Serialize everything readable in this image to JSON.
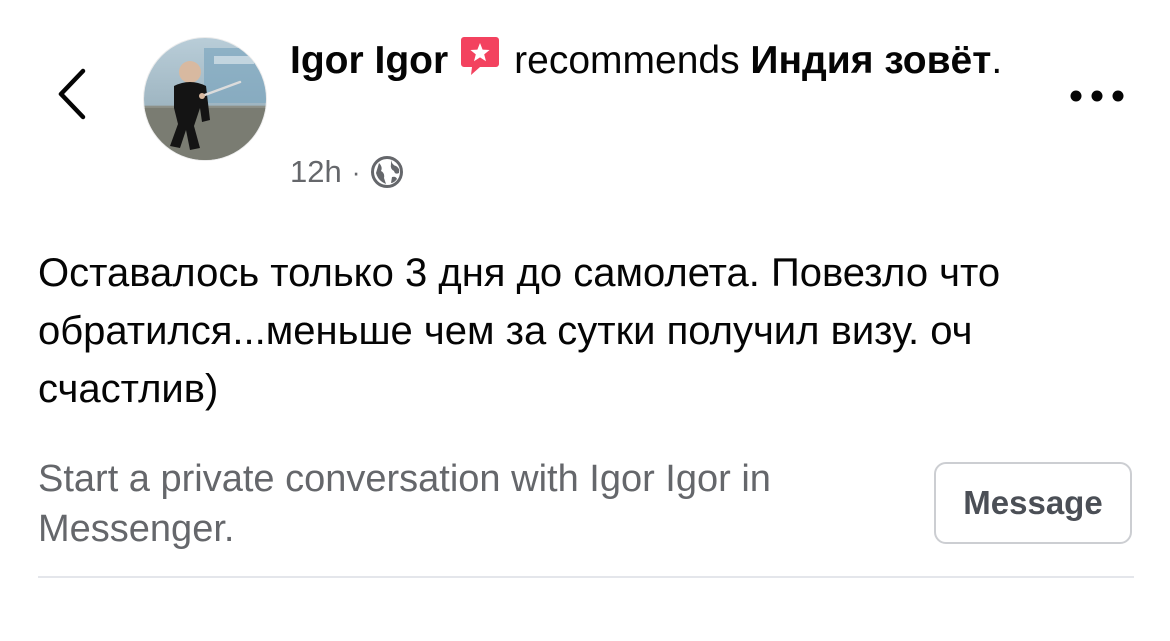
{
  "post": {
    "author": "Igor Igor",
    "recommends_word": "recommends",
    "page_name": "Индия зовёт",
    "page_suffix": ".",
    "time": "12h",
    "separator": "·",
    "audience_icon": "globe-icon",
    "badge_icon": "recommendation-star-icon",
    "badge_color": "#f3425f",
    "body": "Оставалось только 3 дня до самолета. Повезло что обратился...меньше чем за сутки получил визу. оч счастлив)"
  },
  "nav": {
    "back_icon": "chevron-left-icon",
    "more_icon": "more-horizontal-icon"
  },
  "cta": {
    "text": "Start a private conversation with Igor Igor in Messenger.",
    "button_label": "Message"
  },
  "colors": {
    "primary_text": "#050505",
    "secondary_text": "#65676b",
    "border": "#ccced2",
    "divider": "#e4e6eb"
  }
}
